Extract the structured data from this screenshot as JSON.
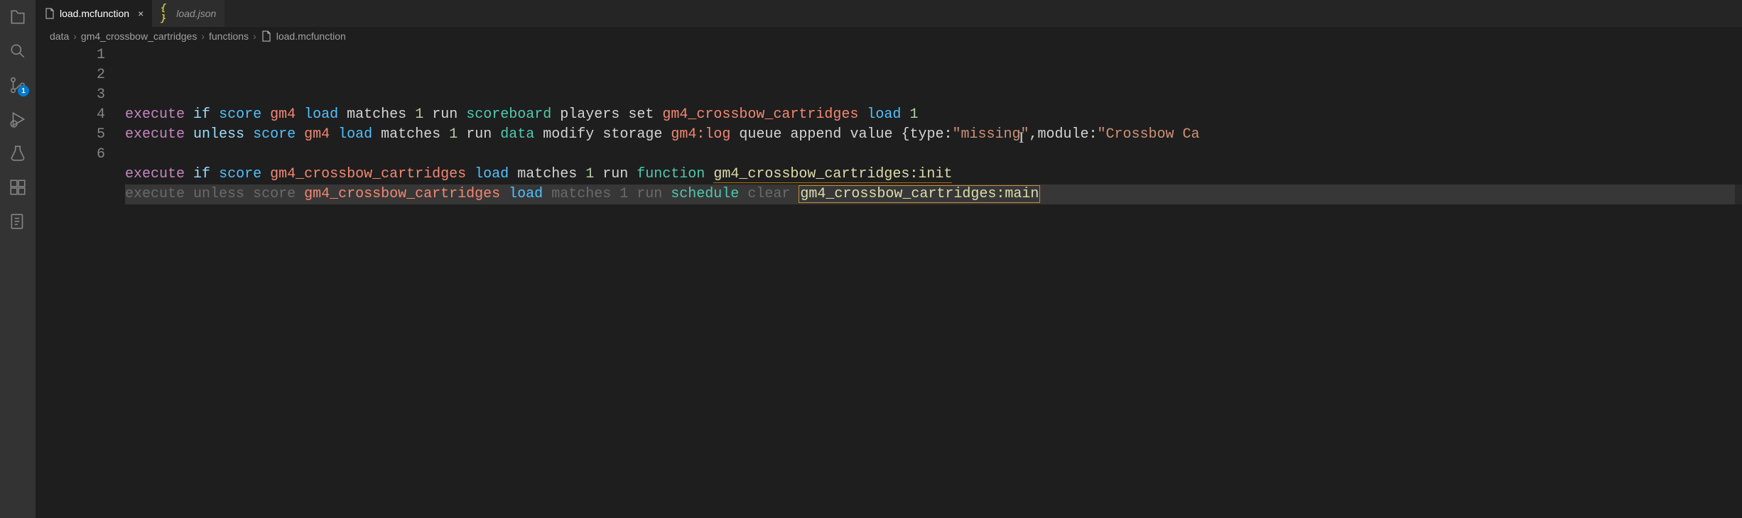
{
  "activity_bar": {
    "icons": [
      "explorer",
      "search",
      "source-control",
      "run-debug",
      "testing",
      "extensions",
      "references"
    ],
    "source_control_badge": "1"
  },
  "tabs": [
    {
      "label": "load.mcfunction",
      "active": true,
      "icon": "file"
    },
    {
      "label": "load.json",
      "active": false,
      "icon": "json"
    }
  ],
  "breadcrumb": {
    "segments": [
      "data",
      "gm4_crossbow_cartridges",
      "functions",
      "load.mcfunction"
    ]
  },
  "editor": {
    "line_numbers": [
      "1",
      "2",
      "3",
      "4",
      "5",
      "6"
    ],
    "lines": [
      {
        "tokens": [
          {
            "t": "execute",
            "c": "kw-exec"
          },
          {
            "t": " ",
            "c": "plain"
          },
          {
            "t": "if",
            "c": "kw-cond"
          },
          {
            "t": " ",
            "c": "plain"
          },
          {
            "t": "score",
            "c": "kw-sub"
          },
          {
            "t": " ",
            "c": "plain"
          },
          {
            "t": "gm4",
            "c": "ident-red"
          },
          {
            "t": " ",
            "c": "plain"
          },
          {
            "t": "load",
            "c": "store"
          },
          {
            "t": " ",
            "c": "plain"
          },
          {
            "t": "matches",
            "c": "plain"
          },
          {
            "t": " ",
            "c": "plain"
          },
          {
            "t": "1",
            "c": "num"
          },
          {
            "t": " ",
            "c": "plain"
          },
          {
            "t": "run",
            "c": "plain"
          },
          {
            "t": " ",
            "c": "plain"
          },
          {
            "t": "scoreboard",
            "c": "cmd"
          },
          {
            "t": " ",
            "c": "plain"
          },
          {
            "t": "players",
            "c": "plain"
          },
          {
            "t": " ",
            "c": "plain"
          },
          {
            "t": "set",
            "c": "plain"
          },
          {
            "t": " ",
            "c": "plain"
          },
          {
            "t": "gm4_crossbow_cartridges",
            "c": "ident-red"
          },
          {
            "t": " ",
            "c": "plain"
          },
          {
            "t": "load",
            "c": "store"
          },
          {
            "t": " ",
            "c": "plain"
          },
          {
            "t": "1",
            "c": "num"
          }
        ]
      },
      {
        "tokens": [
          {
            "t": "execute",
            "c": "kw-exec"
          },
          {
            "t": " ",
            "c": "plain"
          },
          {
            "t": "unless",
            "c": "kw-cond"
          },
          {
            "t": " ",
            "c": "plain"
          },
          {
            "t": "score",
            "c": "kw-sub"
          },
          {
            "t": " ",
            "c": "plain"
          },
          {
            "t": "gm4",
            "c": "ident-red"
          },
          {
            "t": " ",
            "c": "plain"
          },
          {
            "t": "load",
            "c": "store"
          },
          {
            "t": " ",
            "c": "plain"
          },
          {
            "t": "matches",
            "c": "plain"
          },
          {
            "t": " ",
            "c": "plain"
          },
          {
            "t": "1",
            "c": "num"
          },
          {
            "t": " ",
            "c": "plain"
          },
          {
            "t": "run",
            "c": "plain"
          },
          {
            "t": " ",
            "c": "plain"
          },
          {
            "t": "data",
            "c": "cmd"
          },
          {
            "t": " ",
            "c": "plain"
          },
          {
            "t": "modify",
            "c": "plain"
          },
          {
            "t": " ",
            "c": "plain"
          },
          {
            "t": "storage",
            "c": "plain"
          },
          {
            "t": " ",
            "c": "plain"
          },
          {
            "t": "gm4:log",
            "c": "ident-red"
          },
          {
            "t": " ",
            "c": "plain"
          },
          {
            "t": "queue",
            "c": "plain"
          },
          {
            "t": " ",
            "c": "plain"
          },
          {
            "t": "append",
            "c": "plain"
          },
          {
            "t": " ",
            "c": "plain"
          },
          {
            "t": "value",
            "c": "plain"
          },
          {
            "t": " ",
            "c": "plain"
          },
          {
            "t": "{type:",
            "c": "plain"
          },
          {
            "t": "\"missing\"",
            "c": "val"
          },
          {
            "t": ",module:",
            "c": "plain"
          },
          {
            "t": "\"Crossbow Ca",
            "c": "val"
          }
        ]
      },
      {
        "tokens": []
      },
      {
        "tokens": [
          {
            "t": "execute",
            "c": "kw-exec"
          },
          {
            "t": " ",
            "c": "plain"
          },
          {
            "t": "if",
            "c": "kw-cond"
          },
          {
            "t": " ",
            "c": "plain"
          },
          {
            "t": "score",
            "c": "kw-sub"
          },
          {
            "t": " ",
            "c": "plain"
          },
          {
            "t": "gm4_crossbow_cartridges",
            "c": "ident-red"
          },
          {
            "t": " ",
            "c": "plain"
          },
          {
            "t": "load",
            "c": "store"
          },
          {
            "t": " ",
            "c": "plain"
          },
          {
            "t": "matches",
            "c": "plain"
          },
          {
            "t": " ",
            "c": "plain"
          },
          {
            "t": "1",
            "c": "num"
          },
          {
            "t": " ",
            "c": "plain"
          },
          {
            "t": "run",
            "c": "plain"
          },
          {
            "t": " ",
            "c": "plain"
          },
          {
            "t": "function",
            "c": "cmd"
          },
          {
            "t": " ",
            "c": "plain"
          },
          {
            "t": "gm4_crossbow_cartridges:init",
            "c": "ident ns-under"
          }
        ]
      },
      {
        "highlight": true,
        "tokens": [
          {
            "t": "execute",
            "c": "dim"
          },
          {
            "t": " ",
            "c": "dim"
          },
          {
            "t": "unless",
            "c": "dim"
          },
          {
            "t": " ",
            "c": "dim"
          },
          {
            "t": "score",
            "c": "dim"
          },
          {
            "t": " ",
            "c": "dim"
          },
          {
            "t": "gm4_crossbow_cartridges",
            "c": "ident-red"
          },
          {
            "t": " ",
            "c": "dim"
          },
          {
            "t": "load",
            "c": "store"
          },
          {
            "t": " ",
            "c": "dim"
          },
          {
            "t": "matches",
            "c": "dim"
          },
          {
            "t": " ",
            "c": "dim"
          },
          {
            "t": "1",
            "c": "dim"
          },
          {
            "t": " ",
            "c": "dim"
          },
          {
            "t": "run",
            "c": "dim"
          },
          {
            "t": " ",
            "c": "dim"
          },
          {
            "t": "schedule",
            "c": "cmd"
          },
          {
            "t": " ",
            "c": "dim"
          },
          {
            "t": "clear",
            "c": "dim"
          },
          {
            "t": " ",
            "c": "dim"
          },
          {
            "t": "gm4_crossbow_cartridges:main",
            "c": "ident ns-boxed ns-under"
          }
        ]
      },
      {
        "tokens": []
      }
    ]
  }
}
